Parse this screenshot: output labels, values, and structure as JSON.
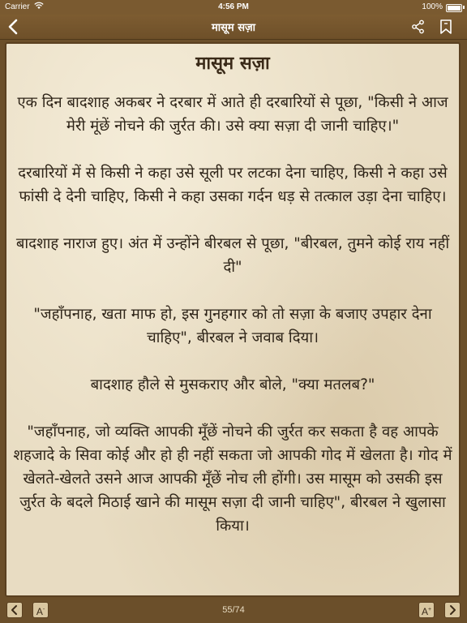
{
  "status": {
    "carrier": "Carrier",
    "time": "4:56 PM",
    "battery": "100%"
  },
  "nav": {
    "title": "मासूम सज़ा"
  },
  "story": {
    "title": "मासूम सज़ा",
    "paragraphs": [
      "एक दिन बादशाह अकबर ने दरबार में आते ही दरबारियों से पूछा, \"किसी ने आज मेरी मूंछें नोचने की जुर्रत की। उसे क्या सज़ा दी जानी चाहिए।\"",
      "दरबारियों में से किसी ने कहा उसे सूली पर लटका देना चाहिए, किसी ने कहा उसे फांसी दे देनी चाहिए, किसी ने कहा उसका गर्दन धड़ से तत्काल उड़ा देना चाहिए।",
      "बादशाह नाराज हुए। अंत में उन्होंने बीरबल से पूछा, \"बीरबल, तुमने कोई राय नहीं दी\"",
      "\"जहाँपनाह, खता माफ हो, इस गुनहगार को तो सज़ा के बजाए उपहार देना चाहिए\", बीरबल ने जवाब दिया।",
      "बादशाह हौले से मुसकराए और बोले, \"क्या मतलब?\"",
      "\"जहाँपनाह, जो व्यक्ति आपकी मूँछें नोचने की जुर्रत कर सकता है वह आपके शहजादे के सिवा कोई और हो ही नहीं सकता जो आपकी गोद में खेलता है। गोद में खेलते-खेलते उसने आज आपकी मूँछें नोच ली होंगी। उस मासूम को उसकी इस जुर्रत के बदले मिठाई खाने की मासूम सज़ा दी जानी चाहिए\", बीरबल ने खुलासा किया।"
    ]
  },
  "footer": {
    "page_indicator": "55/74",
    "font_smaller_label": "A",
    "font_smaller_sup": "-",
    "font_larger_label": "A",
    "font_larger_sup": "+"
  },
  "icons": {
    "back": "chevron-left-icon",
    "share": "share-icon",
    "bookmark": "bookmark-icon",
    "prev": "chevron-left-icon",
    "next": "chevron-right-icon"
  }
}
